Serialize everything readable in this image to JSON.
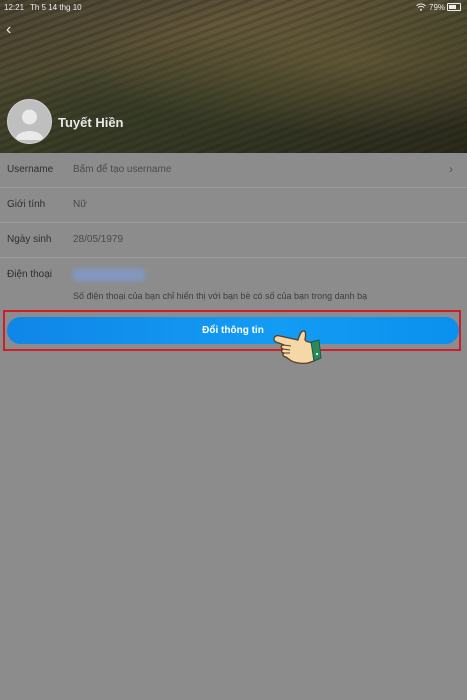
{
  "status_bar": {
    "time": "12:21",
    "date": "Th 5 14 thg 10",
    "battery": "79%",
    "icons": [
      "wifi-icon",
      "battery-icon"
    ]
  },
  "profile": {
    "name": "Tuyết Hiền",
    "icons": [
      "back-icon",
      "avatar-icon"
    ]
  },
  "info": {
    "username": {
      "label": "Username",
      "value": "Bấm để tạo username"
    },
    "gender": {
      "label": "Giới tính",
      "value": "Nữ"
    },
    "birthday": {
      "label": "Ngày sinh",
      "value": "28/05/1979"
    },
    "phone": {
      "label": "Điện thoại",
      "hint": "Số điện thoại của bạn chỉ hiển thị với bạn bè có số của bạn trong danh bạ"
    }
  },
  "actions": {
    "update_label": "Đổi thông tin"
  },
  "colors": {
    "accent_blue": "#139cf4",
    "highlight_red": "#cc1f2b",
    "overlay_gray": "#8c8c8c"
  }
}
